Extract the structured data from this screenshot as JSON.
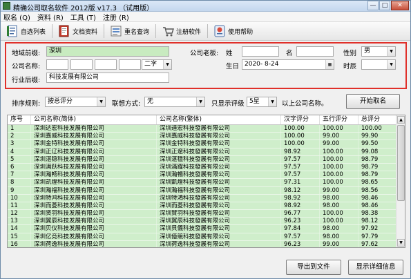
{
  "window": {
    "title": "精确公司取名软件 2012版 v17.3 （试用版）",
    "controls": [
      "—",
      "□",
      "✕"
    ]
  },
  "menu": [
    "取名 (Q)",
    "资料 (R)",
    "工具 (T)",
    "注册 (R)"
  ],
  "toolbar": [
    {
      "label": "自选列表",
      "icon": "list-icon"
    },
    {
      "label": "文档资料",
      "icon": "document-icon"
    },
    {
      "label": "重名查询",
      "icon": "search-duplicate-icon"
    },
    {
      "label": "注册软件",
      "icon": "cart-icon"
    },
    {
      "label": "使用帮助",
      "icon": "help-icon"
    }
  ],
  "form": {
    "region_label": "地域前缀:",
    "region_value": "深圳",
    "company_label": "公司名称:",
    "name_length": "二字",
    "industry_label": "行业后缀:",
    "industry_value": "科技发展有限公司",
    "boss_label": "公司老板:",
    "surname_label": "姓",
    "given_label": "名",
    "gender_label": "性别",
    "gender_value": "男",
    "birthday_label": "生日",
    "birthday_value": "2020- 8-24",
    "hour_label": "时辰",
    "hour_value": ""
  },
  "options": {
    "sort_label": "排序规则:",
    "sort_value": "按总评分",
    "assoc_label": "联想方式:",
    "assoc_value": "无",
    "level_label": "只显示评级",
    "level_value": "5星",
    "level_suffix": "以上公司名称。",
    "start_button": "开始取名"
  },
  "table": {
    "headers": [
      "序号",
      "公司名称(简体)",
      "公司名称(繁体)",
      "汉字评分",
      "五行评分",
      "总评分"
    ],
    "rows": [
      [
        "1",
        "深圳达宏科技发展有限公司",
        "深圳達宏科技發展有限公司",
        "100.00",
        "100.00",
        "100.00"
      ],
      [
        "2",
        "深圳嘉威科技发展有限公司",
        "深圳嘉威科技發展有限公司",
        "100.00",
        "99.00",
        "99.90"
      ],
      [
        "3",
        "深圳金特科技发展有限公司",
        "深圳金特科技發展有限公司",
        "100.00",
        "99.00",
        "99.50"
      ],
      [
        "4",
        "深圳正辽科技发展有限公司",
        "深圳正遼科技發展有限公司",
        "98.92",
        "100.00",
        "99.08"
      ],
      [
        "5",
        "深圳湛稳科技发展有限公司",
        "深圳湛穩科技發展有限公司",
        "97.57",
        "100.00",
        "98.79"
      ],
      [
        "6",
        "深圳满跃科技发展有限公司",
        "深圳滿躍科技發展有限公司",
        "97.57",
        "100.00",
        "98.79"
      ],
      [
        "7",
        "深圳瀚畅科技发展有限公司",
        "深圳瀚暢科技發展有限公司",
        "97.57",
        "100.00",
        "98.79"
      ],
      [
        "8",
        "深圳凯煌科技发展有限公司",
        "深圳凱煌科技發展有限公司",
        "97.31",
        "100.00",
        "98.65"
      ],
      [
        "9",
        "深圳瀚福科技发展有限公司",
        "深圳瀚福科技發展有限公司",
        "98.12",
        "99.00",
        "98.56"
      ],
      [
        "10",
        "深圳特鸿科技发展有限公司",
        "深圳特鴻科技發展有限公司",
        "98.92",
        "98.00",
        "98.46"
      ],
      [
        "11",
        "深圳而菱科技发展有限公司",
        "深圳而菱科技發展有限公司",
        "98.92",
        "98.00",
        "98.46"
      ],
      [
        "12",
        "深圳贤羽科技发展有限公司",
        "深圳賢羽科技發展有限公司",
        "96.77",
        "100.00",
        "98.38"
      ],
      [
        "13",
        "深圳翼辰科技发展有限公司",
        "深圳翼辰科技發展有限公司",
        "96.23",
        "100.00",
        "98.12"
      ],
      [
        "14",
        "深圳贝仪科技发展有限公司",
        "深圳貝儀科技發展有限公司",
        "97.84",
        "98.00",
        "97.92"
      ],
      [
        "15",
        "深圳亿竞科技发展有限公司",
        "深圳億競科技發展有限公司",
        "97.57",
        "98.00",
        "97.79"
      ],
      [
        "16",
        "深圳荷逸科技发展有限公司",
        "深圳荷逸科技發展有限公司",
        "96.23",
        "99.00",
        "97.62"
      ]
    ]
  },
  "footer": {
    "export_button": "导出到文件",
    "details_button": "显示详细信息"
  }
}
